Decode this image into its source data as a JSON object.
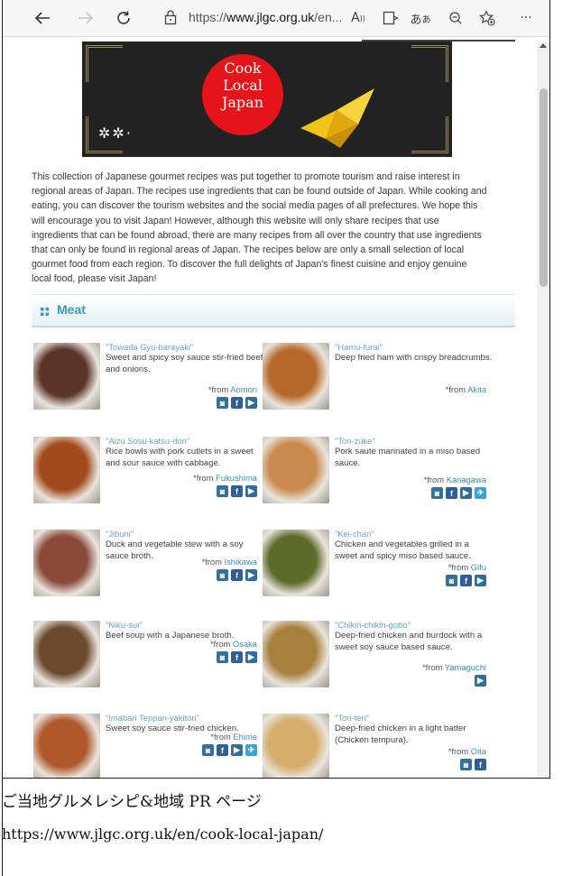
{
  "browser": {
    "url_prefix": "https://",
    "url_domain": "www.jlgc.org.uk",
    "url_rest": "/en...",
    "read_aloud": "Ă",
    "lang_icon": "ああ"
  },
  "intro": "This collection of Japanese gourmet recipes was put together to promote tourism and raise interest in regional areas of Japan. The recipes use ingredients that can be found outside of Japan. While cooking and eating, you can discover the tourism websites and the social media pages of all prefectures. We hope this will encourage you to visit Japan! However, although this website will only share recipes that use ingredients that can be found abroad, there are many recipes from all over the country that use ingredients that can only be found in regional areas of Japan. The recipes below are only a small selection of local gourmet food from each region. To discover the full delights of Japan's finest cuisine and enjoy genuine local food, please visit Japan!",
  "banner": {
    "line1": "Cook",
    "line2": "Local",
    "line3": "Japan"
  },
  "section": {
    "title": "Meat"
  },
  "from_prefix": "*from",
  "recipes": [
    {
      "name": "\"Towada Gyu-barayaki\"",
      "desc": "Sweet and spicy soy sauce stir-fried beef and onions.",
      "region": "Aomori",
      "social": [
        "ig",
        "fb",
        "yt"
      ],
      "color": "#5a3428"
    },
    {
      "name": "\"Hamu-furai\"",
      "desc": "Deep fried ham with crispy breadcrumbs.",
      "region": "Akita",
      "social": [],
      "color": "#b5682a"
    },
    {
      "name": "\"Aizu Sosu-katsu-don\"",
      "desc": "Rice bowls with pork cutlets in a sweet and sour sauce with cabbage.",
      "region": "Fukushima",
      "social": [
        "ig",
        "fb",
        "yt"
      ],
      "color": "#a24a1c"
    },
    {
      "name": "\"Ton-zuke\"",
      "desc": "Pork saute marinated in a miso based sauce.",
      "region": "Kanagawa",
      "social": [
        "ig",
        "fb",
        "yt",
        "tw"
      ],
      "color": "#c98a4f"
    },
    {
      "name": "\"Jibuni\"",
      "desc": "Duck and vegetable stew with a soy sauce broth.",
      "region": "Ishikawa",
      "social": [
        "ig",
        "fb",
        "yt"
      ],
      "color": "#8a4a3a"
    },
    {
      "name": "\"Kei-chan\"",
      "desc": "Chicken and vegetables grilled in a sweet and spicy miso based sauce.",
      "region": "Gifu",
      "social": [
        "ig",
        "fb",
        "yt"
      ],
      "color": "#5c6a2a"
    },
    {
      "name": "\"Niku-sui\"",
      "desc": "Beef soup with a Japanese broth.",
      "region": "Osaka",
      "social": [
        "ig",
        "fb",
        "yt"
      ],
      "color": "#6b4a2e"
    },
    {
      "name": "\"Chikin-chikin-gobo\"",
      "desc": "Deep-fried chicken and burdock with a sweet soy sauce based sauce.",
      "region": "Yamaguchi",
      "social": [
        "yt"
      ],
      "color": "#a8803e"
    },
    {
      "name": "\"Imabari Teppan-yakitori\"",
      "desc": "Sweet soy sauce stir-fried chicken.",
      "region": "Ehime",
      "social": [
        "ig",
        "fb",
        "yt",
        "tw"
      ],
      "color": "#b0582c"
    },
    {
      "name": "\"Tori-ten\"",
      "desc": "Deep-fried chicken in a light batter (Chicken tempura).",
      "region": "Oita",
      "social": [
        "ig",
        "fb"
      ],
      "color": "#d6ad6a"
    }
  ],
  "caption": {
    "text": "ご当地グルメレシピ&地域 PR ページ",
    "url": "https://www.jlgc.org.uk/en/cook-local-japan/"
  },
  "colors": {
    "accent": "#3c99b3",
    "link": "#3c8fb3",
    "banner_red": "#e5141a"
  }
}
